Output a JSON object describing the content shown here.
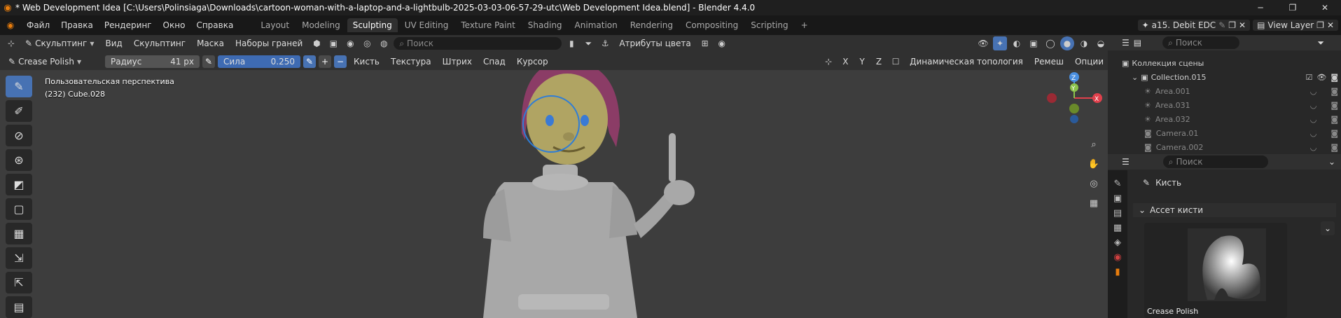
{
  "titlebar": {
    "title": "* Web Development Idea [C:\\Users\\Polinsiaga\\Downloads\\cartoon-woman-with-a-laptop-and-a-lightbulb-2025-03-03-06-57-29-utc\\Web Development Idea.blend] - Blender 4.4.0"
  },
  "menubar": {
    "menus": [
      "Файл",
      "Правка",
      "Рендеринг",
      "Окно",
      "Справка"
    ],
    "tabs": [
      "Layout",
      "Modeling",
      "Sculpting",
      "UV Editing",
      "Texture Paint",
      "Shading",
      "Animation",
      "Rendering",
      "Compositing",
      "Scripting"
    ],
    "active_tab": "Sculpting",
    "add": "+",
    "scene": "a15. Debit EDC",
    "view_layer": "View Layer"
  },
  "header1": {
    "mode": "Скульптинг",
    "view": "Вид",
    "sculpt": "Скульптинг",
    "mask": "Маска",
    "face_sets": "Наборы граней",
    "search_placeholder": "Поиск",
    "color_attr": "Атрибуты цвета"
  },
  "header2": {
    "brush": "Crease Polish",
    "radius_label": "Радиус",
    "radius_value": "41 px",
    "strength_label": "Сила",
    "strength_value": "0.250",
    "brush_menu": "Кисть",
    "texture": "Текстура",
    "stroke": "Штрих",
    "falloff": "Спад",
    "cursor": "Курсор",
    "x": "X",
    "y": "Y",
    "z": "Z",
    "dyntopo": "Динамическая топология",
    "remesh": "Ремеш",
    "options": "Опции"
  },
  "viewport": {
    "view_name": "Пользовательская перспектива",
    "object_info": "(232) Cube.028"
  },
  "outliner": {
    "search_placeholder": "Поиск",
    "scene_collection": "Коллекция сцены",
    "collection": "Collection.015",
    "items": [
      "Area.001",
      "Area.031",
      "Area.032",
      "Camera.01",
      "Camera.002"
    ]
  },
  "properties": {
    "search_placeholder": "Поиск",
    "brush_title": "Кисть",
    "asset_panel": "Ассет кисти",
    "brush_name": "Crease Polish"
  },
  "colors": {
    "accent": "#4772b3",
    "gizmo_x": "#e0404c",
    "gizmo_y": "#8bc34a",
    "gizmo_z": "#4a8fe0"
  }
}
